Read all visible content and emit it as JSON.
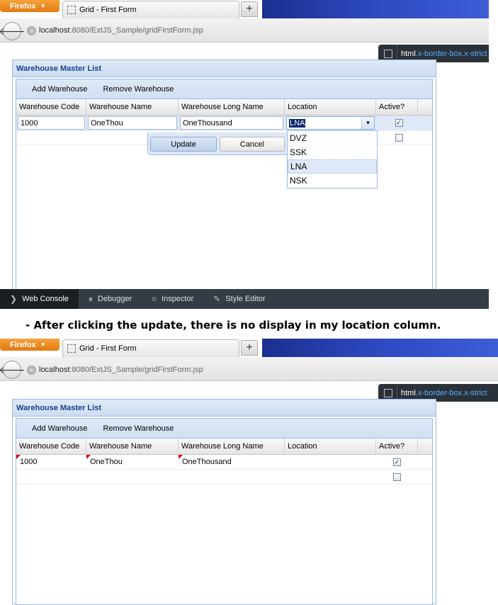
{
  "browser_brand": "Firefox",
  "tab_title": "Grid - First Form",
  "new_tab_symbol": "+",
  "url_host": "localhost",
  "url_path": ":8080/ExtJS_Sample/gridFirstForm.jsp",
  "inspector_crumb": {
    "tag": "html",
    "classes": ".x-border-box.x-strict"
  },
  "panel_title": "Warehouse Master List",
  "toolbar": {
    "add": "Add Warehouse",
    "remove": "Remove Warehouse"
  },
  "columns": [
    "Warehouse Code",
    "Warehouse Name",
    "Warehouse Long Name",
    "Location",
    "Active?"
  ],
  "before": {
    "editor_values": {
      "code": "1000",
      "name": "OneThou",
      "long_name": "OneThousand",
      "location": "LNA"
    },
    "buttons": {
      "update": "Update",
      "cancel": "Cancel"
    },
    "location_options": [
      "DVZ",
      "SSK",
      "LNA",
      "NSK"
    ],
    "selected_option": "LNA",
    "row2_active": false,
    "row1_active": true
  },
  "devtools": [
    "Web Console",
    "Debugger",
    "Inspector",
    "Style Editor"
  ],
  "caption": "- After clicking the update, there is no display in my location column.",
  "after": {
    "rows": [
      {
        "code": "1000",
        "name": "OneThou",
        "long_name": "OneThousand",
        "location": "",
        "active": true
      },
      {
        "code": "",
        "name": "",
        "long_name": "",
        "location": "",
        "active": false
      }
    ]
  },
  "colors": {
    "panel_border": "#99bbe8",
    "panel_title": "#15428b",
    "firefox_orange": "#e8881b",
    "devtools_bg": "#343c45"
  }
}
